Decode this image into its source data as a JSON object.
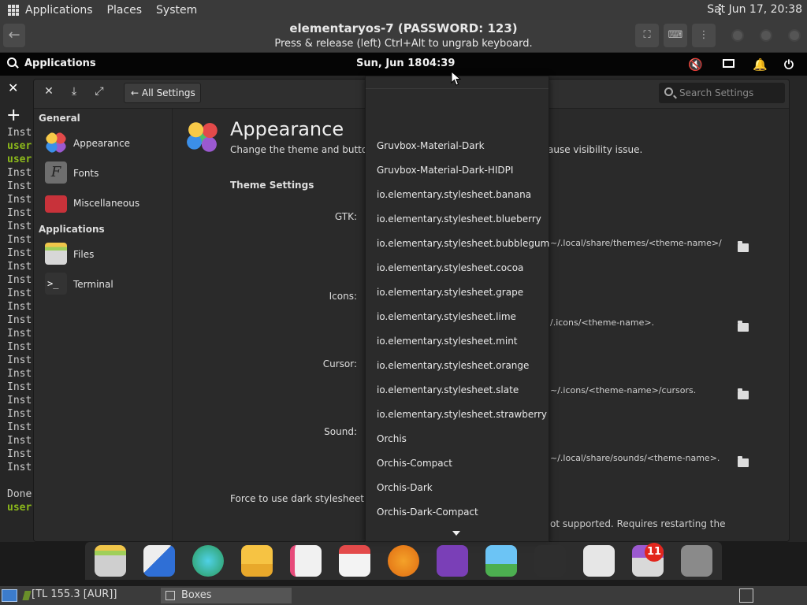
{
  "host_panel": {
    "menus": [
      "Applications",
      "Places",
      "System"
    ],
    "clock": "Sat Jun 17, 20:38"
  },
  "boxes": {
    "title": "elementaryos-7 (PASSWORD: 123)",
    "subtitle": "Press & release (left) Ctrl+Alt to ungrab keyboard."
  },
  "guest_panel": {
    "applications": "Applications",
    "date": "Sun, Jun 18",
    "time": "04:39"
  },
  "terminal": {
    "lines": [
      {
        "t": "Inst",
        "g": false
      },
      {
        "t": "user",
        "g": true
      },
      {
        "t": "user",
        "g": true
      },
      {
        "t": "Inst",
        "g": false
      },
      {
        "t": "Inst",
        "g": false
      },
      {
        "t": "Inst",
        "g": false
      },
      {
        "t": "Inst",
        "g": false
      },
      {
        "t": "Inst",
        "g": false
      },
      {
        "t": "Inst",
        "g": false
      },
      {
        "t": "Inst",
        "g": false
      },
      {
        "t": "Inst",
        "g": false
      },
      {
        "t": "Inst",
        "g": false
      },
      {
        "t": "Inst",
        "g": false
      },
      {
        "t": "Inst",
        "g": false
      },
      {
        "t": "Inst",
        "g": false
      },
      {
        "t": "Inst",
        "g": false
      },
      {
        "t": "Inst",
        "g": false
      },
      {
        "t": "Inst",
        "g": false
      },
      {
        "t": "Inst",
        "g": false
      },
      {
        "t": "Inst",
        "g": false
      },
      {
        "t": "Inst",
        "g": false
      },
      {
        "t": "Inst",
        "g": false
      },
      {
        "t": "Inst",
        "g": false
      },
      {
        "t": "Inst",
        "g": false
      },
      {
        "t": "Inst",
        "g": false
      },
      {
        "t": "Inst",
        "g": false
      },
      {
        "t": "",
        "g": false
      },
      {
        "t": "Done",
        "g": false
      },
      {
        "t": "user",
        "g": true
      }
    ]
  },
  "settings": {
    "all_settings": "All Settings",
    "search_placeholder": "Search Settings",
    "sidebar": {
      "general_header": "General",
      "general_items": [
        "Appearance",
        "Fonts",
        "Miscellaneous"
      ],
      "applications_header": "Applications",
      "application_items": [
        "Files",
        "Terminal"
      ]
    },
    "appearance": {
      "title": "Appearance",
      "desc": "Change the theme and button l",
      "desc_tail": "ause visibility issue.",
      "theme_settings": "Theme Settings",
      "rows": [
        {
          "label": "GTK:",
          "path": "~/.local/share/themes/<theme-name>/"
        },
        {
          "label": "Icons:",
          "path": "/.icons/<theme-name>."
        },
        {
          "label": "Cursor:",
          "path": "~/.icons/<theme-name>/cursors."
        },
        {
          "label": "Sound:",
          "path": "~/.local/share/sounds/<theme-name>."
        }
      ],
      "force_dark": "Force to use dark stylesheet:",
      "force_tail": "ot supported. Requires restarting the"
    },
    "dropdown_items": [
      "Gruvbox-Material-Dark",
      "Gruvbox-Material-Dark-HIDPI",
      "io.elementary.stylesheet.banana",
      "io.elementary.stylesheet.blueberry",
      "io.elementary.stylesheet.bubblegum",
      "io.elementary.stylesheet.cocoa",
      "io.elementary.stylesheet.grape",
      "io.elementary.stylesheet.lime",
      "io.elementary.stylesheet.mint",
      "io.elementary.stylesheet.orange",
      "io.elementary.stylesheet.slate",
      "io.elementary.stylesheet.strawberry",
      "Orchis",
      "Orchis-Compact",
      "Orchis-Dark",
      "Orchis-Dark-Compact"
    ]
  },
  "dock": {
    "apps": [
      "files-icon",
      "multitasking-view-icon",
      "web-browser-icon",
      "mail-icon",
      "tasks-icon",
      "calendar-icon",
      "music-icon",
      "videos-icon",
      "photos-icon",
      "terminal-icon",
      "system-settings-icon",
      "appcenter-icon",
      "trash-icon"
    ],
    "badge": "11"
  },
  "taskbar": {
    "item1": "[TL 155.3 [AUR]]",
    "item2": "Boxes"
  }
}
